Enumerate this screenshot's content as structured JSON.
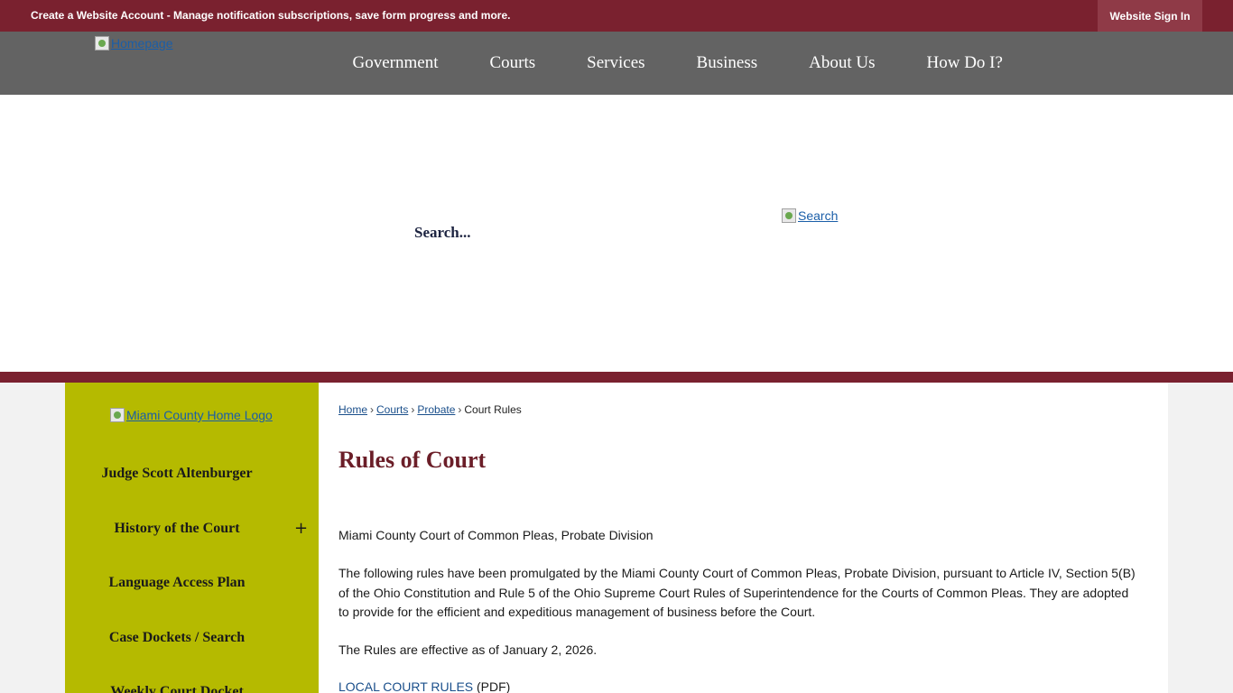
{
  "top_bar": {
    "account_link": "Create a Website Account",
    "account_desc": " - Manage notification subscriptions, save form progress and more.",
    "sign_in": "Website Sign In"
  },
  "nav": {
    "home_alt": "Homepage",
    "items": [
      "Government",
      "Courts",
      "Services",
      "Business",
      "About Us",
      "How Do I?"
    ]
  },
  "search": {
    "placeholder": "Search...",
    "button_alt": "Search"
  },
  "sidebar": {
    "logo_alt": "Miami County Home Logo",
    "items": [
      "Judge Scott Altenburger",
      "History of the Court",
      "Language Access Plan",
      "Case Dockets / Search",
      "Weekly Court Docket"
    ],
    "expand_symbol": "+"
  },
  "breadcrumb": {
    "home": "Home",
    "courts": "Courts",
    "probate": "Probate",
    "current": "Court Rules",
    "separator": "›"
  },
  "main": {
    "title": "Rules of Court",
    "intro": "Miami County Court of Common Pleas, Probate Division",
    "body": "The following rules have been promulgated by the Miami County Court of Common Pleas, Probate Division, pursuant to Article IV, Section 5(B) of the Ohio Constitution and Rule 5 of the Ohio Supreme Court Rules of Superintendence for the Courts of Common Pleas. They are adopted to provide for the efficient and expeditious management of business before the Court.",
    "effective": "The Rules are effective as of January 2, 2026.",
    "doc_link": "LOCAL COURT RULES",
    "doc_type": " (PDF)"
  },
  "colors": {
    "maroon": "#7a212f",
    "nav_gray": "#636363",
    "sidebar_olive": "#b5ba00",
    "title_maroon": "#6b1e28",
    "link_blue": "#1a4f8b"
  }
}
